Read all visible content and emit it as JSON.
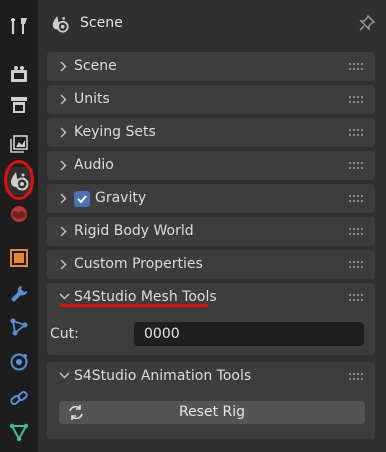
{
  "header": {
    "title": "Scene"
  },
  "panels": [
    {
      "label": "Scene"
    },
    {
      "label": "Units"
    },
    {
      "label": "Keying Sets"
    },
    {
      "label": "Audio"
    },
    {
      "label": "Gravity",
      "checked": true
    },
    {
      "label": "Rigid Body World"
    },
    {
      "label": "Custom Properties"
    }
  ],
  "mesh_tools": {
    "title": "S4Studio Mesh Tools",
    "cut_label": "Cut:",
    "cut_value": "0000"
  },
  "animation_tools": {
    "title": "S4Studio Animation Tools",
    "reset_label": "Reset Rig"
  },
  "sidebar": {
    "tabs": [
      "tool-icon",
      "render-icon",
      "output-icon",
      "view-layer-icon",
      "scene-icon",
      "world-icon",
      "object-icon",
      "modifier-icon",
      "particles-icon",
      "physics-icon",
      "constraints-icon",
      "data-icon"
    ],
    "active": "scene-icon"
  },
  "colors": {
    "accent": "#4772b3",
    "highlight": "#e01010"
  }
}
